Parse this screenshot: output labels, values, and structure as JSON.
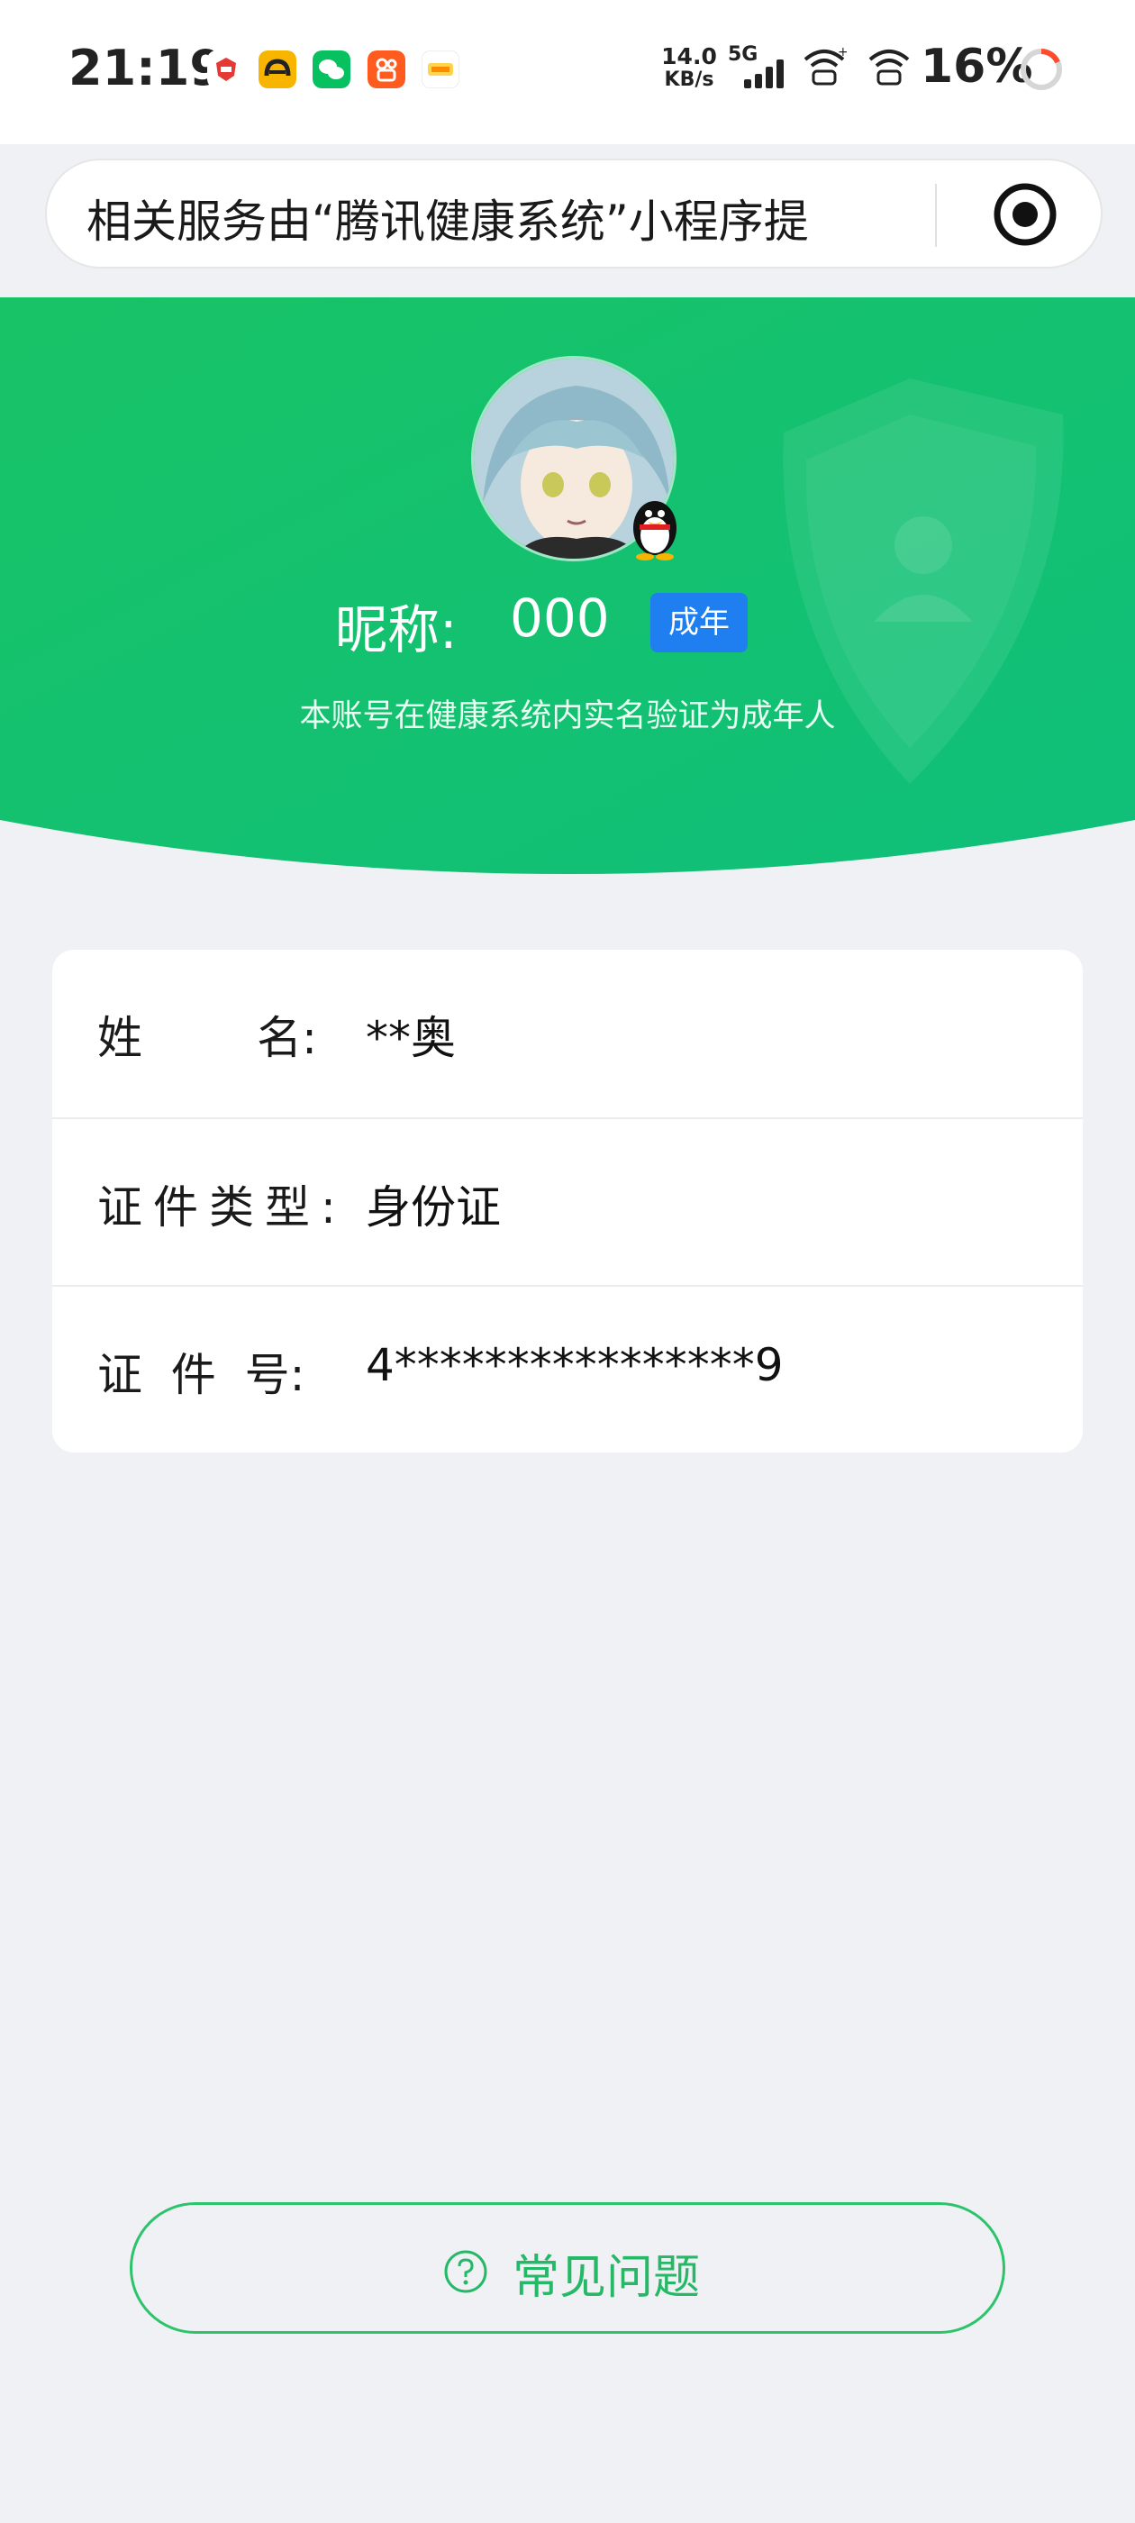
{
  "status_bar": {
    "time": "21:19",
    "network_speed_value": "14.0",
    "network_speed_unit": "KB/s",
    "network_type": "5G",
    "battery": "16%"
  },
  "top_bar": {
    "text": "相关服务由“腾讯健康系统”小程序提",
    "record_icon": "record-icon"
  },
  "profile": {
    "nickname_label": "昵称:",
    "nickname_value": "000",
    "adult_badge": "成年",
    "verify_text": "本账号在健康系统内实名验证为成年人"
  },
  "info": {
    "rows": [
      {
        "label": "姓        名:",
        "value": "**奥"
      },
      {
        "label": "证件类型:",
        "value": "身份证"
      },
      {
        "label": "证  件  号:",
        "value": "4****************9"
      }
    ]
  },
  "faq": {
    "label": "常见问题",
    "icon": "question-circle-icon"
  },
  "colors": {
    "green": "#1fc46a",
    "badge_blue": "#1f7ff0",
    "faq_green": "#25b866"
  }
}
